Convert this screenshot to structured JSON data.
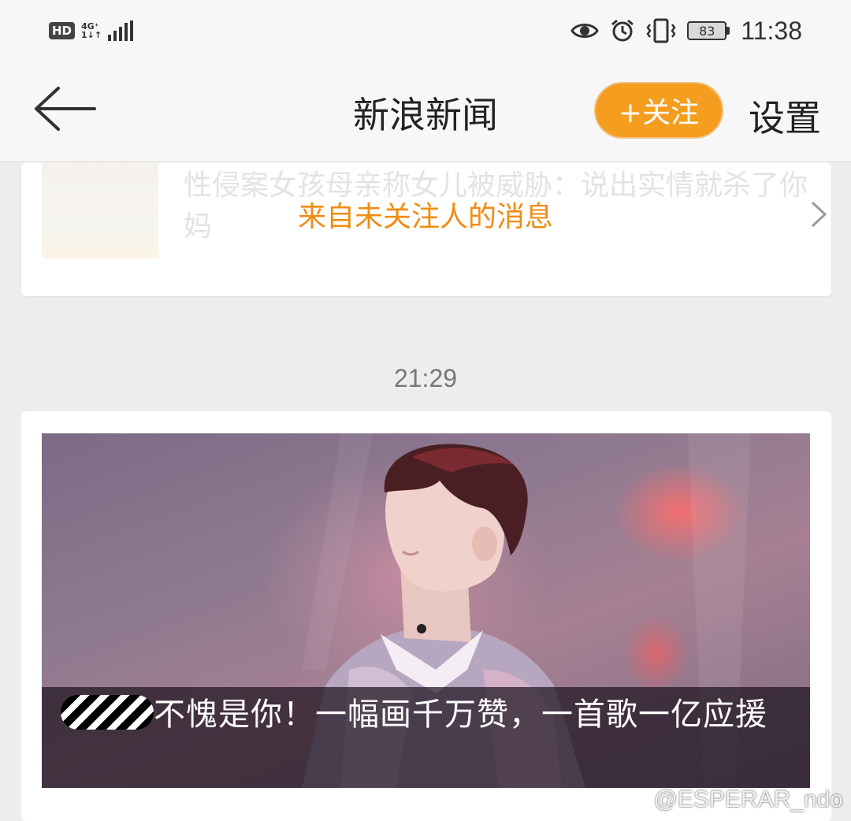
{
  "status_bar": {
    "hd_badge": "HD",
    "network_top": "4G⁺",
    "network_bottom": "1↓↑",
    "battery_level": "83",
    "time": "11:38",
    "icons": [
      "eye-icon",
      "alarm-icon",
      "vibrate-icon",
      "battery-icon"
    ]
  },
  "nav": {
    "title": "新浪新闻",
    "follow_label": "+关注",
    "settings_label": "设置",
    "accent_color": "#f59d1f"
  },
  "top_card": {
    "faded_title": "性侵案女孩母亲称女儿被威胁：说出实情就杀了你妈",
    "banner_text": "来自未关注人的消息"
  },
  "timestamp": "21:29",
  "news_card": {
    "caption_text": "不愧是你！一幅画千万赞，一首歌一亿应援"
  },
  "watermark": "@ESPERAR_ndo"
}
